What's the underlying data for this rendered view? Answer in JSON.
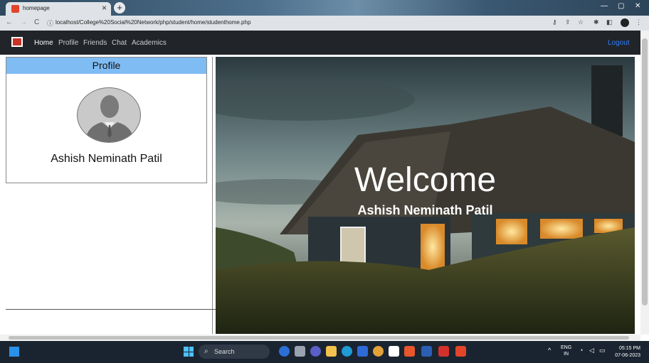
{
  "browser": {
    "tab_title": "homepage",
    "url": "localhost/College%20Social%20Network/php/student/home/studenthome.php"
  },
  "navbar": {
    "links": [
      "Home",
      "Profile",
      "Friends",
      "Chat",
      "Academics"
    ],
    "logout": "Logout"
  },
  "profile": {
    "header": "Profile",
    "name": "Ashish Neminath Patil"
  },
  "hero": {
    "title": "Welcome",
    "name": "Ashish Neminath Patil"
  },
  "taskbar": {
    "search": "Search",
    "lang_line1": "ENG",
    "lang_line2": "IN",
    "time": "05:15 PM",
    "date": "07-06-2023"
  },
  "colors": {
    "navbar_bg": "#212529",
    "profile_header": "#7fbcf3",
    "logout_link": "#2f7cf6"
  }
}
